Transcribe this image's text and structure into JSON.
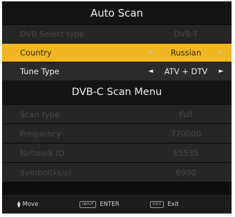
{
  "title": "Auto Scan",
  "rows": [
    {
      "label": "DVB Select type",
      "value": "DVB-T"
    },
    {
      "label": "Country",
      "value": "Russian",
      "left_arrow": "◄",
      "right_arrow": "►"
    },
    {
      "label": "Tune Type",
      "value": "ATV + DTV",
      "left_arrow": "◄",
      "right_arrow": "►"
    }
  ],
  "section_title": "DVB-C Scan Menu",
  "scan_rows": [
    {
      "label": "Scan type",
      "value": "Full"
    },
    {
      "label": "Frequency",
      "value": "770000"
    },
    {
      "label": "Network ID",
      "value": "65535"
    },
    {
      "label": "Symbol(ks/s)",
      "value": "6900"
    }
  ],
  "footer": {
    "move_up_glyph": "▲",
    "move_down_glyph": "▼",
    "move_label": "Move",
    "enter_key": "INPUT",
    "enter_label": "ENTER",
    "exit_key": "EXIT",
    "exit_label": "Exit"
  },
  "colors": {
    "selected_row": "#f0b722",
    "panel_background": "#0d0d0d",
    "disabled_text": "#474747"
  }
}
